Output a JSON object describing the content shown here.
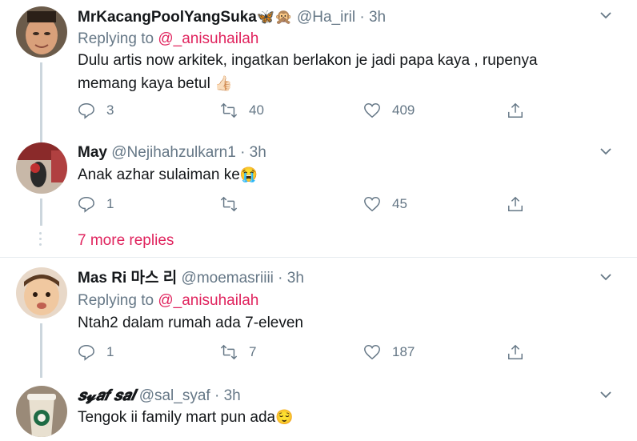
{
  "colors": {
    "accent": "#e0245e",
    "muted": "#657786",
    "line": "#ccd6dd"
  },
  "tweets": [
    {
      "name": "MrKacangPoolYangSuka",
      "name_emoji": "🦋🙊",
      "handle": "@Ha_iril",
      "time": "· 3h",
      "replying_prefix": "Replying to",
      "replying_to": "@_anisuhailah",
      "text_line1": "Dulu artis now arkitek, ingatkan berlakon je jadi papa kaya , rupenya",
      "text_line2": "memang kaya betul",
      "text_emoji": "👍🏻",
      "replies": "3",
      "retweets": "40",
      "likes": "409"
    },
    {
      "name": "May",
      "handle": "@Nejihahzulkarn1",
      "time": "· 3h",
      "text_line1": "Anak azhar sulaiman ke",
      "text_emoji": "😭",
      "replies": "1",
      "retweets": "",
      "likes": "45"
    },
    {
      "name": "Mas Ri 마스 리",
      "handle": "@moemasriiii",
      "time": "· 3h",
      "replying_prefix": "Replying to",
      "replying_to": "@_anisuhailah",
      "text_line1": "Ntah2 dalam rumah ada 7-eleven",
      "replies": "1",
      "retweets": "7",
      "likes": "187"
    },
    {
      "name": "𝒔𝔂𝒂𝒇 𝒔𝒂𝒍",
      "handle": "@sal_syaf",
      "time": "· 3h",
      "text_line1": "Tengok ii family mart pun ada",
      "text_emoji": "😌"
    }
  ],
  "more_replies": "7 more replies",
  "icons": {
    "reply": "reply-icon",
    "retweet": "retweet-icon",
    "like": "heart-icon",
    "share": "share-icon",
    "menu": "chevron-down-icon"
  }
}
